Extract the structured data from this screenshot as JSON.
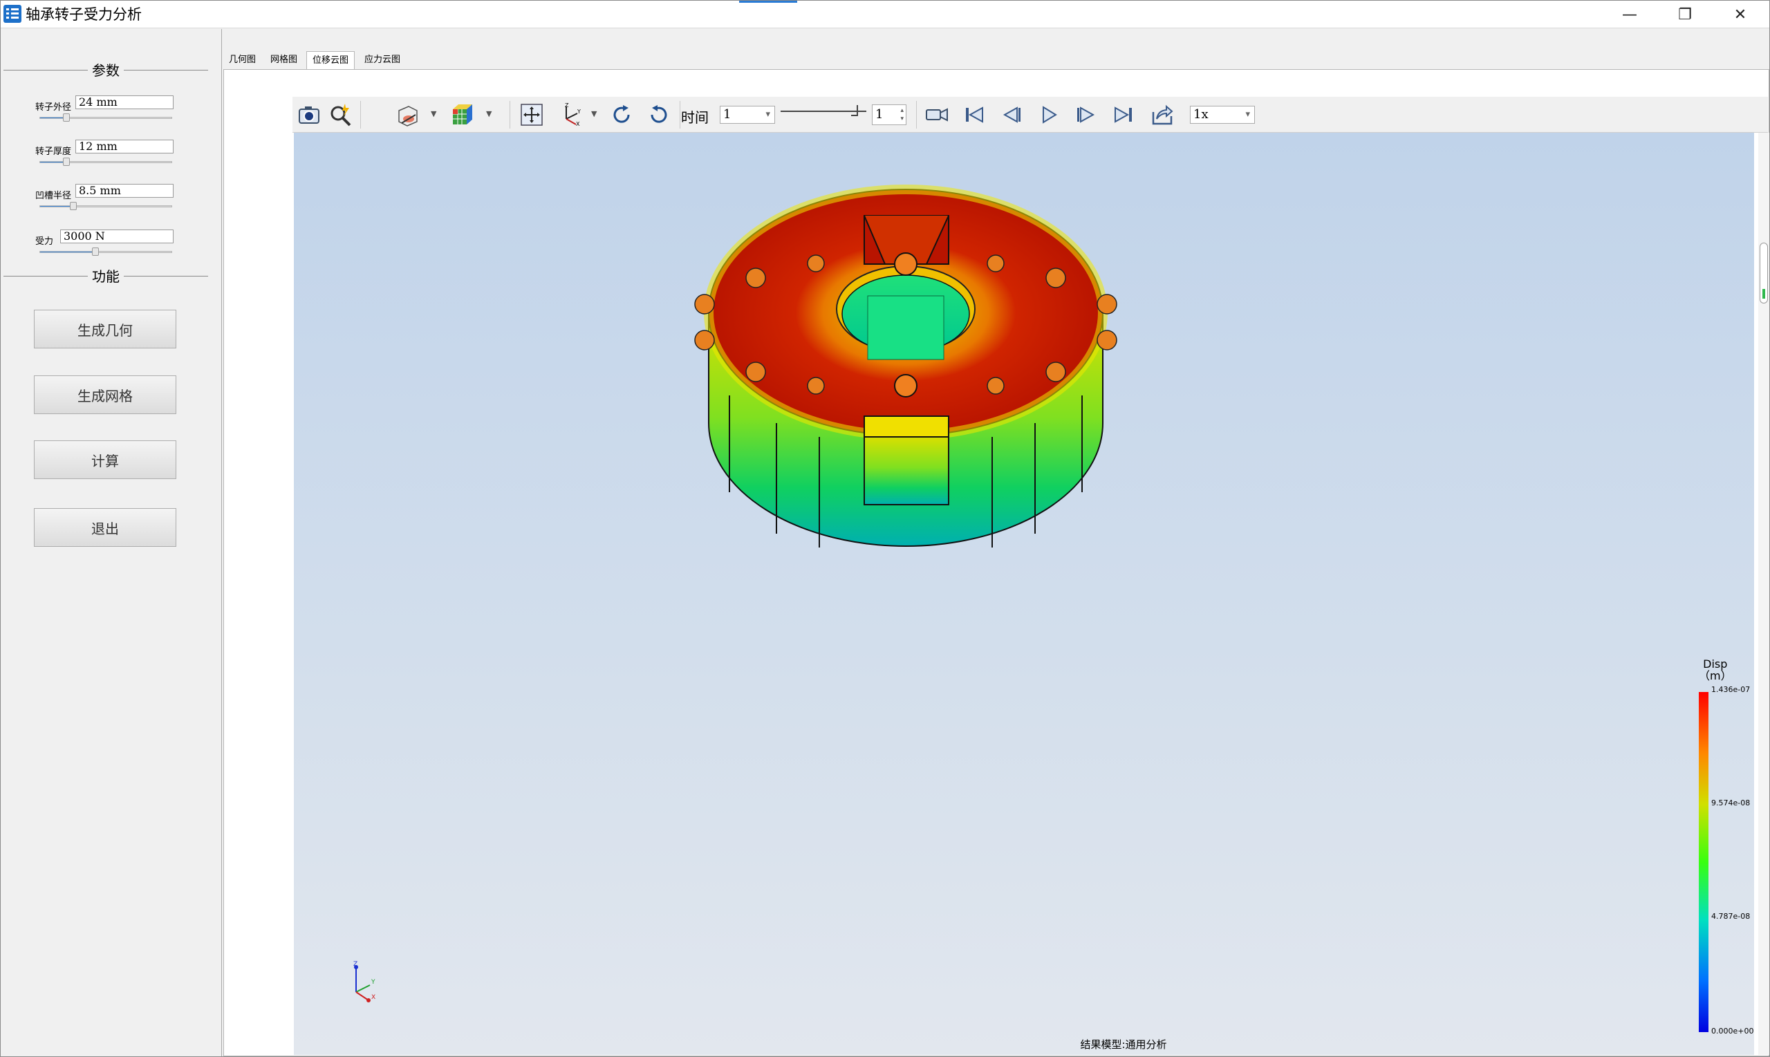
{
  "window": {
    "title": "轴承转子受力分析",
    "min_icon": "minimize-icon",
    "max_icon": "restore-icon",
    "close_icon": "close-icon"
  },
  "left_panel": {
    "params_section": "参数",
    "params": [
      {
        "label": "转子外径",
        "value": "24 mm",
        "slider_fraction": 0.2
      },
      {
        "label": "转子厚度",
        "value": "12 mm",
        "slider_fraction": 0.2
      },
      {
        "label": "凹槽半径",
        "value": "8.5 mm",
        "slider_fraction": 0.25
      },
      {
        "label": "受力",
        "value": "3000 N",
        "slider_fraction": 0.42
      }
    ],
    "functions_section": "功能",
    "buttons": [
      "生成几何",
      "生成网格",
      "计算",
      "退出"
    ]
  },
  "tabs": [
    "几何图",
    "网格图",
    "位移云图",
    "应力云图"
  ],
  "active_tab": 2,
  "toolbar": {
    "icons": [
      "camera-icon",
      "zoom-fit-icon",
      "render-mode-icon",
      "color-cube-icon",
      "pan-icon",
      "axis-orient-icon",
      "rotate-cw-icon",
      "rotate-ccw-icon",
      "record-icon",
      "first-frame-icon",
      "prev-frame-icon",
      "play-icon",
      "next-frame-icon",
      "last-frame-icon",
      "export-icon"
    ],
    "time_label": "时间",
    "time_value": "1",
    "frame_value": "1",
    "speed_value": "1x"
  },
  "viewport": {
    "result_label": "结果模型:通用分析",
    "legend": {
      "title_line1": "Disp",
      "title_line2": "（m）",
      "ticks": [
        "1.436e-07",
        "9.574e-08",
        "4.787e-08",
        "0.000e+00"
      ]
    }
  }
}
